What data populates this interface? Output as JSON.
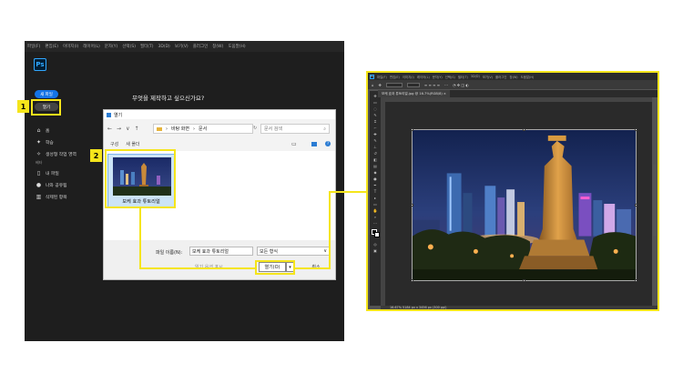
{
  "left_app": {
    "logo": "Ps",
    "menu": [
      "파일(F)",
      "편집(E)",
      "이미지(I)",
      "레이어(L)",
      "문자(Y)",
      "선택(S)",
      "필터(T)",
      "3D(D)",
      "보기(V)",
      "플러그인",
      "창(W)",
      "도움말(H)"
    ],
    "new_file": "새 파일",
    "open": "열기",
    "prompt": "무엇을 제작하고 싶으신가요?",
    "sidebar": [
      {
        "icon": "home-icon",
        "glyph": "⌂",
        "label": "홈"
      },
      {
        "icon": "lightbulb-icon",
        "glyph": "✦",
        "label": "학습"
      },
      {
        "icon": "sparkle-icon",
        "glyph": "✧",
        "label": "생성형 작업 영역"
      },
      {
        "icon": "",
        "glyph": "",
        "label": "베타"
      },
      {
        "icon": "file-icon",
        "glyph": "▯",
        "label": "내 파일"
      },
      {
        "icon": "people-icon",
        "glyph": "●",
        "label": "나와 공유됨"
      },
      {
        "icon": "trash-icon",
        "glyph": "▥",
        "label": "삭제된 항목"
      }
    ]
  },
  "badges": {
    "step1": "1",
    "step2": "2"
  },
  "dialog": {
    "title": "열기",
    "path": [
      "바탕 화면",
      "문서"
    ],
    "search_placeholder": "문서 검색",
    "new_label": "구성",
    "new_folder": "새 폴더",
    "file_label": "보케 효과 튜토리얼",
    "filename_label": "파일 이름(N):",
    "filename_value": "보케 효과 튜토리얼",
    "filetype": "모든 형식",
    "import_options": "읽기 옵션 표시",
    "open_button": "열기(O)",
    "open_dropdown": "▾",
    "cancel_button": "취소",
    "nav_arrows": [
      "←",
      "→",
      "∨",
      "↑"
    ]
  },
  "right_app": {
    "menu": [
      "파일(F)",
      "편집(E)",
      "이미지(I)",
      "레이어(L)",
      "문자(Y)",
      "선택(S)",
      "필터(T)",
      "3D(D)",
      "보기(V)",
      "플러그인",
      "창(W)",
      "도움말(H)"
    ],
    "doc_tab": "보케 효과 튜토리얼.jpg @ 16.7%(RGB/8) ×",
    "status": "16.67%   5184 px x 3456 px (300 ppi)"
  }
}
